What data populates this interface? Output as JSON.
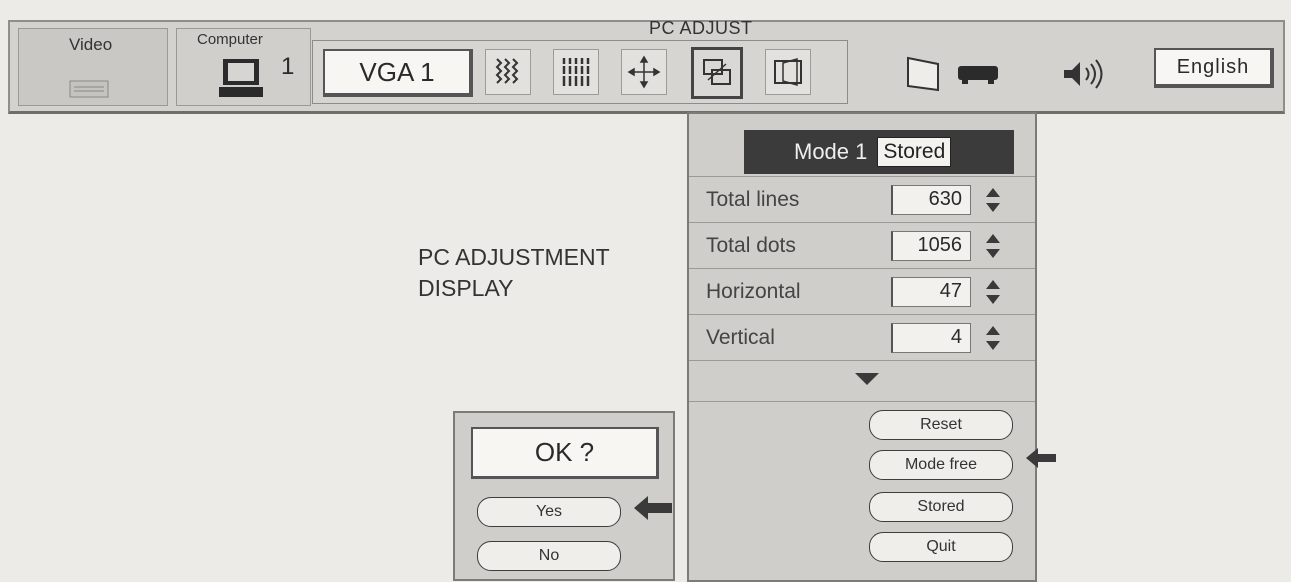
{
  "menubar": {
    "tabs": [
      {
        "label": "Video"
      },
      {
        "label": "Computer",
        "number": "1"
      }
    ],
    "pc_adjust_label": "PC ADJUST",
    "input_source": "VGA 1",
    "language_button": "English",
    "icons": [
      "fine-sync-icon",
      "total-dots-icon",
      "position-icon",
      "pc-adjust-icon",
      "screen-size-icon",
      "screen-icon",
      "projector-icon",
      "speaker-icon"
    ]
  },
  "caption": {
    "line1": "PC ADJUSTMENT",
    "line2": "DISPLAY"
  },
  "panel": {
    "mode_label": "Mode 1",
    "mode_status": "Stored",
    "rows": [
      {
        "label": "Total lines",
        "value": "630"
      },
      {
        "label": "Total dots",
        "value": "1056"
      },
      {
        "label": "Horizontal",
        "value": "47"
      },
      {
        "label": "Vertical",
        "value": "4"
      }
    ],
    "buttons": {
      "reset": "Reset",
      "mode_free": "Mode free",
      "stored": "Stored",
      "quit": "Quit"
    }
  },
  "dialog": {
    "question": "OK ?",
    "yes": "Yes",
    "no": "No"
  },
  "colors": {
    "background": "#ecebe7",
    "panel": "#cfcecb",
    "mode_header": "#3b3b3b"
  }
}
